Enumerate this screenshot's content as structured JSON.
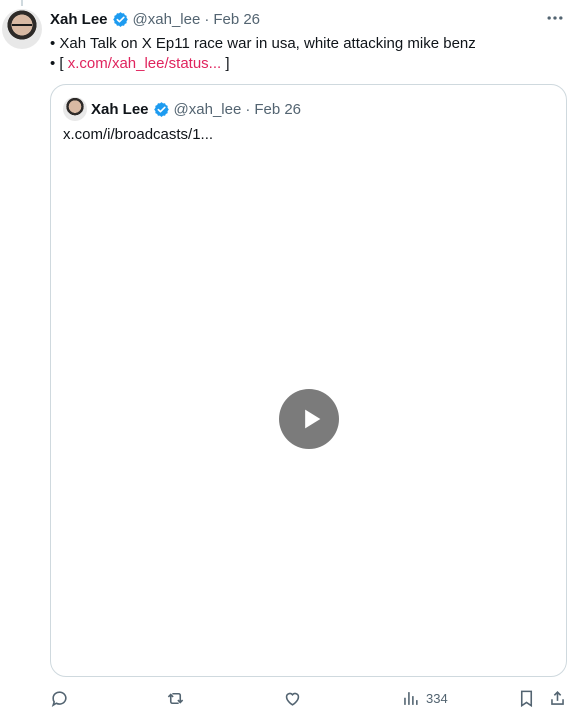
{
  "tweet": {
    "author_name": "Xah Lee",
    "handle": "@xah_lee",
    "separator": "·",
    "date": "Feb 26",
    "line1": "• Xah Talk on X Ep11 race war in usa, white attacking mike benz",
    "line2_prefix": "• [",
    "link_text": "x.com/xah_lee/status...",
    "line2_suffix": "]"
  },
  "quote": {
    "author_name": "Xah Lee",
    "handle": "@xah_lee",
    "separator": "·",
    "date": "Feb 26",
    "body": "x.com/i/broadcasts/1..."
  },
  "actions": {
    "views_count": "334"
  },
  "colors": {
    "link": "#e0245e",
    "verified": "#1d9bf0",
    "secondary_text": "#536471",
    "border": "#cfd9de"
  },
  "icons": [
    "more-icon",
    "verified-icon",
    "play-icon",
    "reply-icon",
    "repost-icon",
    "like-icon",
    "views-icon",
    "bookmark-icon",
    "share-icon"
  ]
}
